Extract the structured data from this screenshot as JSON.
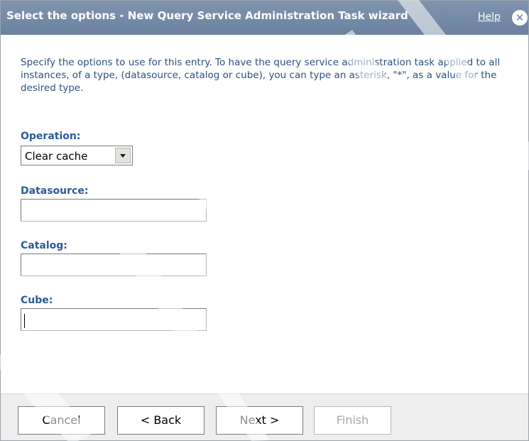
{
  "window": {
    "title": "Select the options - New Query Service Administration Task wizard",
    "help_label": "Help",
    "close_icon": "close-circle-icon"
  },
  "instructions": "Specify the options to use for this entry. To have the query service administration task applied to all instances, of a type, (datasource, catalog or cube), you can type an asterisk, \"*\", as a value for the desired type.",
  "form": {
    "operation": {
      "label": "Operation:",
      "value": "Clear cache",
      "icon": "chevron-down-icon"
    },
    "datasource": {
      "label": "Datasource:",
      "value": ""
    },
    "catalog": {
      "label": "Catalog:",
      "value": ""
    },
    "cube": {
      "label": "Cube:",
      "value": ""
    }
  },
  "footer": {
    "cancel_label": "Cancel",
    "back_label": "< Back",
    "next_label": "Next >",
    "finish_label": "Finish",
    "finish_enabled": false
  },
  "colors": {
    "titlebar": "#6b82a0",
    "label": "#2d5a96",
    "instructions": "#2d4f7e",
    "footer": "#eeeeee"
  }
}
